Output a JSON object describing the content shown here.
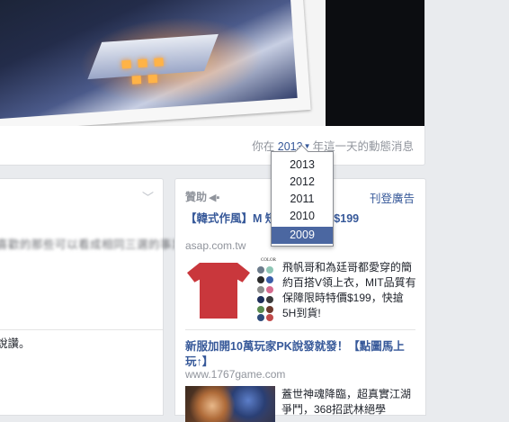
{
  "memory": {
    "prefix": "你在",
    "year": "2013",
    "suffix": "年這一天的動態消息"
  },
  "year_dropdown": {
    "options": [
      "2013",
      "2012",
      "2011",
      "2010",
      "2009"
    ],
    "selected": "2009"
  },
  "left_post": {
    "blurred_text": "喜歡的那些可以看成相同三選的事業",
    "snippet": "說讚。"
  },
  "ads": {
    "sponsored_label": "贊助",
    "create_ad_label": "刊登廣告",
    "items": [
      {
        "title": "【韓式作風】M   短袖上衣14色$199",
        "url": "asap.com.tw",
        "description": "飛帆哥和為廷哥都愛穿的簡約百搭V領上衣，MIT品質有保障限時特價$199，快搶5H到貨!",
        "image_label": "COLOR"
      },
      {
        "title": "新服加開10萬玩家PK說發就發！【點圖馬上玩↑】",
        "url": "www.1767game.com",
        "description": "蓋世神魂降臨，超真實江湖爭鬥，368招武林絕學"
      }
    ]
  },
  "colors": {
    "link": "#365899",
    "muted": "#90949c",
    "selected_bg": "#4b67a1",
    "page_bg": "#e9ebee",
    "shirt": "#c9373c"
  }
}
